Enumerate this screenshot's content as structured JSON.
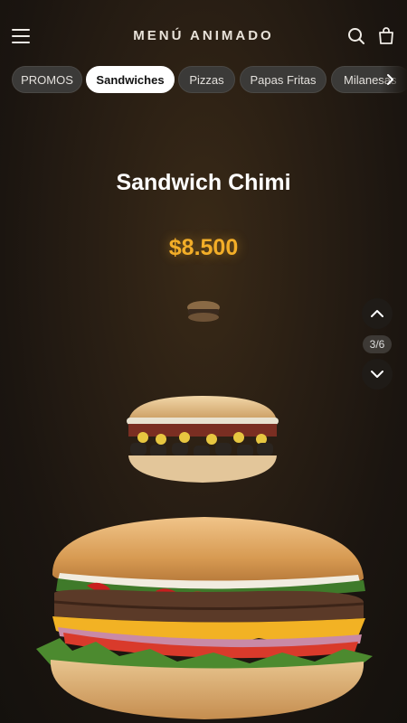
{
  "header": {
    "title": "MENÚ ANIMADO",
    "menu_icon": "hamburger-menu-icon",
    "search_icon": "search-icon",
    "cart_icon": "shopping-bag-icon"
  },
  "categories": {
    "items": [
      {
        "label": "PROMOS",
        "active": false
      },
      {
        "label": "Sandwiches",
        "active": true
      },
      {
        "label": "Pizzas",
        "active": false
      },
      {
        "label": "Papas Fritas",
        "active": false
      },
      {
        "label": "Milanesas",
        "active": false
      }
    ],
    "next_icon": "chevron-right-icon"
  },
  "product": {
    "name": "Sandwich Chimi",
    "price": "$8.500"
  },
  "carousel": {
    "counter": "3/6",
    "prev_icon": "chevron-up-icon",
    "next_icon": "chevron-down-icon"
  },
  "colors": {
    "accent_price": "#f3ae28",
    "tab_active_bg": "#ffffff",
    "tab_bg": "#3b3a38",
    "background": "#1b1510"
  }
}
